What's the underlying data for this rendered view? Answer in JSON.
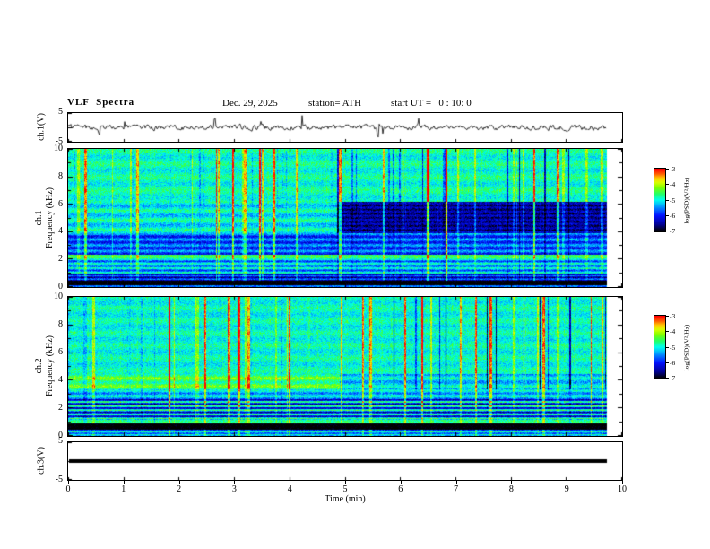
{
  "header": {
    "title": "VLF  Spectra",
    "date": "Dec. 29, 2025",
    "station": "station= ATH",
    "start_ut": "start UT =   0 : 10: 0"
  },
  "xaxis": {
    "label": "Time (min)",
    "ticks": [
      0,
      1,
      2,
      3,
      4,
      5,
      6,
      7,
      8,
      9,
      10
    ],
    "range": [
      0,
      10
    ],
    "data_end_min": 9.72
  },
  "panels": {
    "ch1_wave": {
      "ylabel": "ch.1(V)",
      "ytick_labels": [
        "5",
        "-5"
      ],
      "ylim": [
        -5,
        5
      ]
    },
    "ch1_spec": {
      "ylabel_line1": "ch.1",
      "ylabel_line2": "Frequency (kHz)",
      "yticks": [
        10,
        8,
        6,
        4,
        2,
        0
      ],
      "ylim": [
        0,
        10
      ]
    },
    "ch2_spec": {
      "ylabel_line1": "ch.2",
      "ylabel_line2": "Frequency (kHz)",
      "yticks": [
        10,
        8,
        6,
        4,
        2,
        0
      ],
      "ylim": [
        0,
        10
      ]
    },
    "ch3_wave": {
      "ylabel": "ch.3(V)",
      "ytick_labels": [
        "5",
        "-5"
      ],
      "ylim": [
        -5,
        5
      ]
    }
  },
  "colorbar": {
    "label": "log(PSD)(V²/Hz)",
    "ticks": [
      -3,
      -4,
      -5,
      -6,
      -7
    ],
    "range": [
      -7,
      -3
    ],
    "stops": [
      {
        "t": 0.0,
        "c": "#000000"
      },
      {
        "t": 0.1,
        "c": "#00008f"
      },
      {
        "t": 0.25,
        "c": "#0010ff"
      },
      {
        "t": 0.4,
        "c": "#00a0ff"
      },
      {
        "t": 0.5,
        "c": "#00ffee"
      },
      {
        "t": 0.6,
        "c": "#22ff66"
      },
      {
        "t": 0.7,
        "c": "#7fff00"
      },
      {
        "t": 0.78,
        "c": "#d8ff00"
      },
      {
        "t": 0.85,
        "c": "#ffd000"
      },
      {
        "t": 0.92,
        "c": "#ff6000"
      },
      {
        "t": 1.0,
        "c": "#ff0000"
      }
    ]
  },
  "chart_data": [
    {
      "id": "ch1-waveform",
      "type": "line",
      "ylabel": "ch.1(V)",
      "ylim": [
        -5,
        5
      ],
      "yticks": [
        5,
        -5
      ],
      "xlim": [
        0,
        10
      ],
      "x_end_of_data": 9.72,
      "summary": "Low-amplitude broadband noise centred on 0 V with frequent narrow impulsive spikes (sferics) reaching toward +/-5 V; trace ends near 9.7 min."
    },
    {
      "id": "ch1-spectrogram",
      "type": "heatmap",
      "ylabel": "ch.1 Frequency (kHz)",
      "ylim": [
        0,
        10
      ],
      "yticks": [
        0,
        2,
        4,
        6,
        8,
        10
      ],
      "xlim": [
        0,
        10
      ],
      "x_end_of_data": 9.72,
      "zlabel": "log(PSD)(V²/Hz)",
      "zlim": [
        -7,
        -3
      ],
      "colorbar_ticks": [
        -3,
        -4,
        -5,
        -6,
        -7
      ],
      "features": [
        "green/cyan background near -5 over 6-10 kHz with dense bright vertical streaks (yellow/red impulses)",
        "dark navy suppressed block from ~4.9 min to end of data between ~4 and 6 kHz",
        "striped blue/cyan region 2-4 kHz with horizontal banding",
        "bright green horizontal line near 2.2 kHz",
        "black band below ~0.4 kHz",
        "white gap after ~9.7 min (no data)"
      ]
    },
    {
      "id": "ch2-spectrogram",
      "type": "heatmap",
      "ylabel": "ch.2 Frequency (kHz)",
      "ylim": [
        0,
        10
      ],
      "yticks": [
        0,
        2,
        4,
        6,
        8,
        10
      ],
      "xlim": [
        0,
        10
      ],
      "x_end_of_data": 9.72,
      "zlabel": "log(PSD)(V²/Hz)",
      "zlim": [
        -7,
        -3
      ],
      "colorbar_ticks": [
        -3,
        -4,
        -5,
        -6,
        -7
      ],
      "features": [
        "green background with bright vertical streaks over 4-10 kHz",
        "many dark blue vertical streaks above ~3.5 kHz after ~5 min",
        "bright green/yellow band 3.4-4.4 kHz before ~5 min",
        "strong horizontal yellow/green/blue banding between 0.8 and 2.6 kHz",
        "black band ~0.5-0.85 kHz",
        "white gap after ~9.7 min (no data)"
      ]
    },
    {
      "id": "ch3-waveform",
      "type": "line",
      "ylabel": "ch.3(V)",
      "ylim": [
        -5,
        5
      ],
      "yticks": [
        5,
        -5
      ],
      "xlim": [
        0,
        10
      ],
      "x_end_of_data": 9.72,
      "summary": "Constant flat trace at 0 V drawn as a thick black line (channel inactive)."
    }
  ]
}
